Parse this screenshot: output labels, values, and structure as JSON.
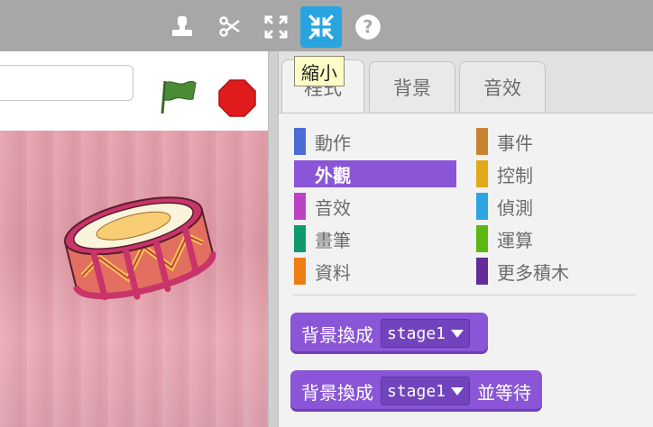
{
  "toolbar": {
    "tools": [
      {
        "icon": "stamp-icon"
      },
      {
        "icon": "scissors-icon"
      },
      {
        "icon": "expand-icon"
      },
      {
        "icon": "shrink-icon",
        "active": true
      },
      {
        "icon": "help-icon"
      }
    ]
  },
  "tooltip": "縮小",
  "tabs": [
    {
      "label": "程式",
      "active": true
    },
    {
      "label": "背景",
      "active": false
    },
    {
      "label": "音效",
      "active": false
    }
  ],
  "categories": [
    {
      "label": "動作",
      "color": "#4a6cd4"
    },
    {
      "label": "外觀",
      "color": "#8a55d7",
      "selected": true
    },
    {
      "label": "音效",
      "color": "#bb42c3"
    },
    {
      "label": "畫筆",
      "color": "#0e9a6c"
    },
    {
      "label": "資料",
      "color": "#ee7d16"
    },
    {
      "label": "事件",
      "color": "#c88330"
    },
    {
      "label": "控制",
      "color": "#e1a91a"
    },
    {
      "label": "偵測",
      "color": "#2ca5e2"
    },
    {
      "label": "運算",
      "color": "#5cb712"
    },
    {
      "label": "更多積木",
      "color": "#632d99"
    }
  ],
  "blocks": [
    {
      "text": "背景換成",
      "dropdown": "stage1",
      "suffix": ""
    },
    {
      "text": "背景換成",
      "dropdown": "stage1",
      "suffix": "並等待"
    }
  ],
  "colors": {
    "looks": "#8a55d7",
    "toolbar": "#a7a7a7",
    "active_tool": "#28a5e0"
  }
}
